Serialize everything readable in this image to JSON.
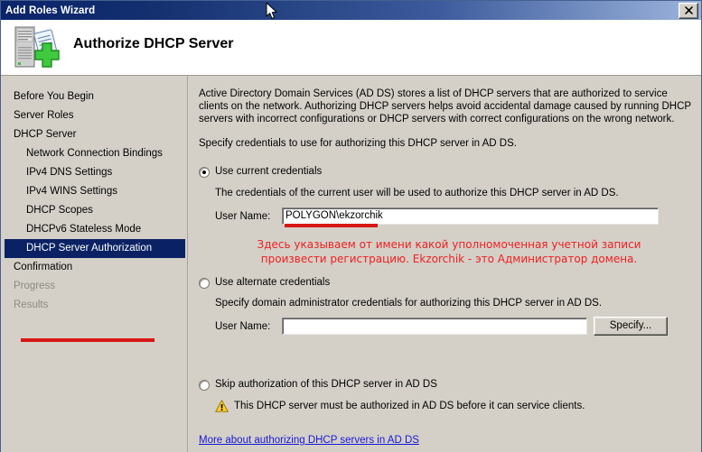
{
  "window": {
    "title": "Add Roles Wizard",
    "close_label": "✕"
  },
  "header": {
    "title": "Authorize DHCP Server",
    "icon": "server-with-plus-icon"
  },
  "sidebar": {
    "items": [
      {
        "label": "Before You Begin",
        "level": 0,
        "state": "normal"
      },
      {
        "label": "Server Roles",
        "level": 0,
        "state": "normal"
      },
      {
        "label": "DHCP Server",
        "level": 0,
        "state": "normal"
      },
      {
        "label": "Network Connection Bindings",
        "level": 1,
        "state": "normal"
      },
      {
        "label": "IPv4 DNS Settings",
        "level": 1,
        "state": "normal"
      },
      {
        "label": "IPv4 WINS Settings",
        "level": 1,
        "state": "normal"
      },
      {
        "label": "DHCP Scopes",
        "level": 1,
        "state": "normal"
      },
      {
        "label": "DHCPv6 Stateless Mode",
        "level": 1,
        "state": "normal"
      },
      {
        "label": "DHCP Server Authorization",
        "level": 1,
        "state": "selected"
      },
      {
        "label": "Confirmation",
        "level": 0,
        "state": "normal"
      },
      {
        "label": "Progress",
        "level": 0,
        "state": "disabled"
      },
      {
        "label": "Results",
        "level": 0,
        "state": "disabled"
      }
    ]
  },
  "main": {
    "paragraph1": "Active Directory Domain Services (AD DS) stores a list of DHCP servers that are authorized to service clients on the network. Authorizing DHCP servers helps avoid accidental damage caused by running DHCP servers with incorrect configurations or DHCP servers with correct configurations on the wrong network.",
    "paragraph2": "Specify credentials to use for authorizing this DHCP server in AD DS.",
    "option_current": {
      "label": "Use current credentials",
      "selected": true,
      "description": "The credentials of the current user will be used to authorize this DHCP server in AD DS.",
      "username_label": "User Name:",
      "username_value": "POLYGON\\ekzorchik"
    },
    "option_alternate": {
      "label": "Use alternate credentials",
      "selected": false,
      "description": "Specify domain administrator credentials for authorizing this DHCP server in AD DS.",
      "username_label": "User Name:",
      "username_value": "",
      "specify_button": "Specify..."
    },
    "option_skip": {
      "label": "Skip authorization of this DHCP server in AD DS",
      "selected": false,
      "warning_text": "This DHCP server must be authorized in AD DS before it can service clients.",
      "warning_icon": "warning-triangle-icon"
    },
    "help_link": "More about authorizing DHCP servers in AD DS"
  },
  "annotation": {
    "line1": "Здесь указываем от имени какой уполномоченная учетной записи",
    "line2": "произвести регистрацию. Ekzorchik - это Администратор домена.",
    "color": "#ef2020"
  },
  "colors": {
    "title_bar_start": "#0a246a",
    "title_bar_end": "#9cb4dc",
    "dialog_bg": "#d4d0c8",
    "selected_item_bg": "#0a2264",
    "annotation_red": "#ef2020",
    "link_blue": "#1818d8",
    "warning_yellow": "#ffcc00"
  }
}
